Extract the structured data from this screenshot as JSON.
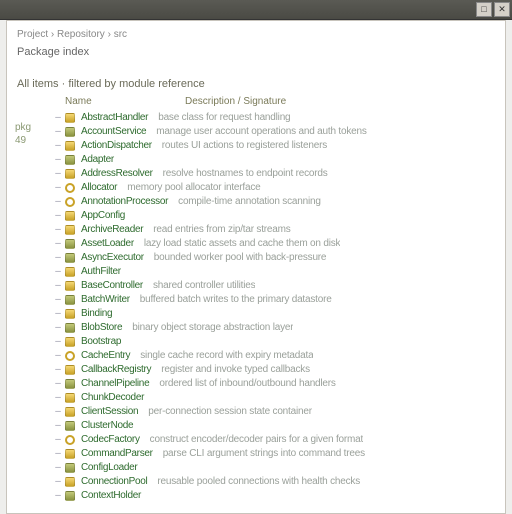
{
  "titlebar": {
    "maximize": "□",
    "close": "✕"
  },
  "header": {
    "breadcrumb": "Project › Repository › src",
    "subtitle": "Package index",
    "section": "All items · filtered by module reference"
  },
  "side": {
    "label1": "pkg",
    "label2": "49"
  },
  "columns": {
    "name": "Name",
    "description": "Description / Signature"
  },
  "items": [
    {
      "icon": "gold",
      "name": "AbstractHandler",
      "desc": "base class for request handling"
    },
    {
      "icon": "olive",
      "name": "AccountService",
      "desc": "manage user account operations and auth tokens"
    },
    {
      "icon": "gold",
      "name": "ActionDispatcher",
      "desc": "routes UI actions to registered listeners"
    },
    {
      "icon": "olive",
      "name": "Adapter",
      "desc": ""
    },
    {
      "icon": "gold",
      "name": "AddressResolver",
      "desc": "resolve hostnames to endpoint records"
    },
    {
      "icon": "ring",
      "name": "Allocator",
      "desc": "memory pool allocator interface"
    },
    {
      "icon": "ring",
      "name": "AnnotationProcessor",
      "desc": "compile-time annotation scanning"
    },
    {
      "icon": "gold",
      "name": "AppConfig",
      "desc": ""
    },
    {
      "icon": "gold",
      "name": "ArchiveReader",
      "desc": "read entries from zip/tar streams"
    },
    {
      "icon": "olive",
      "name": "AssetLoader",
      "desc": "lazy load static assets and cache them on disk"
    },
    {
      "icon": "olive",
      "name": "AsyncExecutor",
      "desc": "bounded worker pool with back-pressure"
    },
    {
      "icon": "gold",
      "name": "AuthFilter",
      "desc": ""
    },
    {
      "icon": "gold",
      "name": "BaseController",
      "desc": "shared controller utilities"
    },
    {
      "icon": "olive",
      "name": "BatchWriter",
      "desc": "buffered batch writes to the primary datastore"
    },
    {
      "icon": "gold",
      "name": "Binding",
      "desc": ""
    },
    {
      "icon": "olive",
      "name": "BlobStore",
      "desc": "binary object storage abstraction layer"
    },
    {
      "icon": "gold",
      "name": "Bootstrap",
      "desc": ""
    },
    {
      "icon": "ring",
      "name": "CacheEntry",
      "desc": "single cache record with expiry metadata"
    },
    {
      "icon": "gold",
      "name": "CallbackRegistry",
      "desc": "register and invoke typed callbacks"
    },
    {
      "icon": "olive",
      "name": "ChannelPipeline",
      "desc": "ordered list of inbound/outbound handlers"
    },
    {
      "icon": "gold",
      "name": "ChunkDecoder",
      "desc": ""
    },
    {
      "icon": "gold",
      "name": "ClientSession",
      "desc": "per-connection session state container"
    },
    {
      "icon": "olive",
      "name": "ClusterNode",
      "desc": ""
    },
    {
      "icon": "ring",
      "name": "CodecFactory",
      "desc": "construct encoder/decoder pairs for a given format"
    },
    {
      "icon": "gold",
      "name": "CommandParser",
      "desc": "parse CLI argument strings into command trees"
    },
    {
      "icon": "olive",
      "name": "ConfigLoader",
      "desc": ""
    },
    {
      "icon": "gold",
      "name": "ConnectionPool",
      "desc": "reusable pooled connections with health checks"
    },
    {
      "icon": "olive",
      "name": "ContextHolder",
      "desc": ""
    }
  ]
}
